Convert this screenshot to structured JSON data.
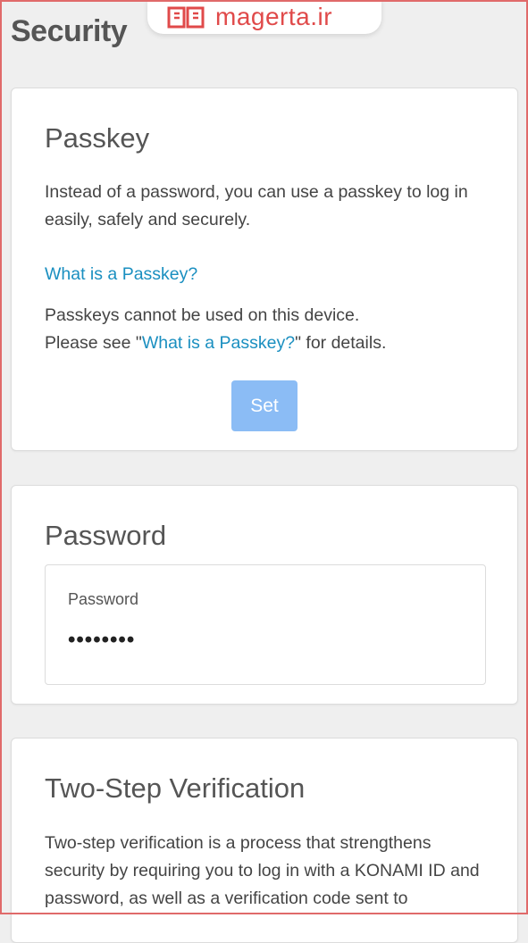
{
  "page": {
    "title": "Security"
  },
  "watermark": {
    "text": "magerta.ir"
  },
  "passkey": {
    "title": "Passkey",
    "description": "Instead of a password, you can use a passkey to log in easily, safely and securely.",
    "link_label": "What is a Passkey?",
    "notice_line1": "Passkeys cannot be used on this device.",
    "notice_prefix": "Please see \"",
    "notice_link": "What is a Passkey?",
    "notice_suffix": "\" for details.",
    "set_button": "Set"
  },
  "password": {
    "title": "Password",
    "field_label": "Password",
    "field_value": "••••••••"
  },
  "two_step": {
    "title": "Two-Step Verification",
    "description": "Two-step verification is a process that strengthens security by requiring you to log in with a KONAMI ID and password, as well as a verification code sent to"
  },
  "colors": {
    "link": "#1a8fc0",
    "button_disabled": "#8bbcf5",
    "watermark_red": "#e04a4a",
    "background": "#efefef"
  }
}
